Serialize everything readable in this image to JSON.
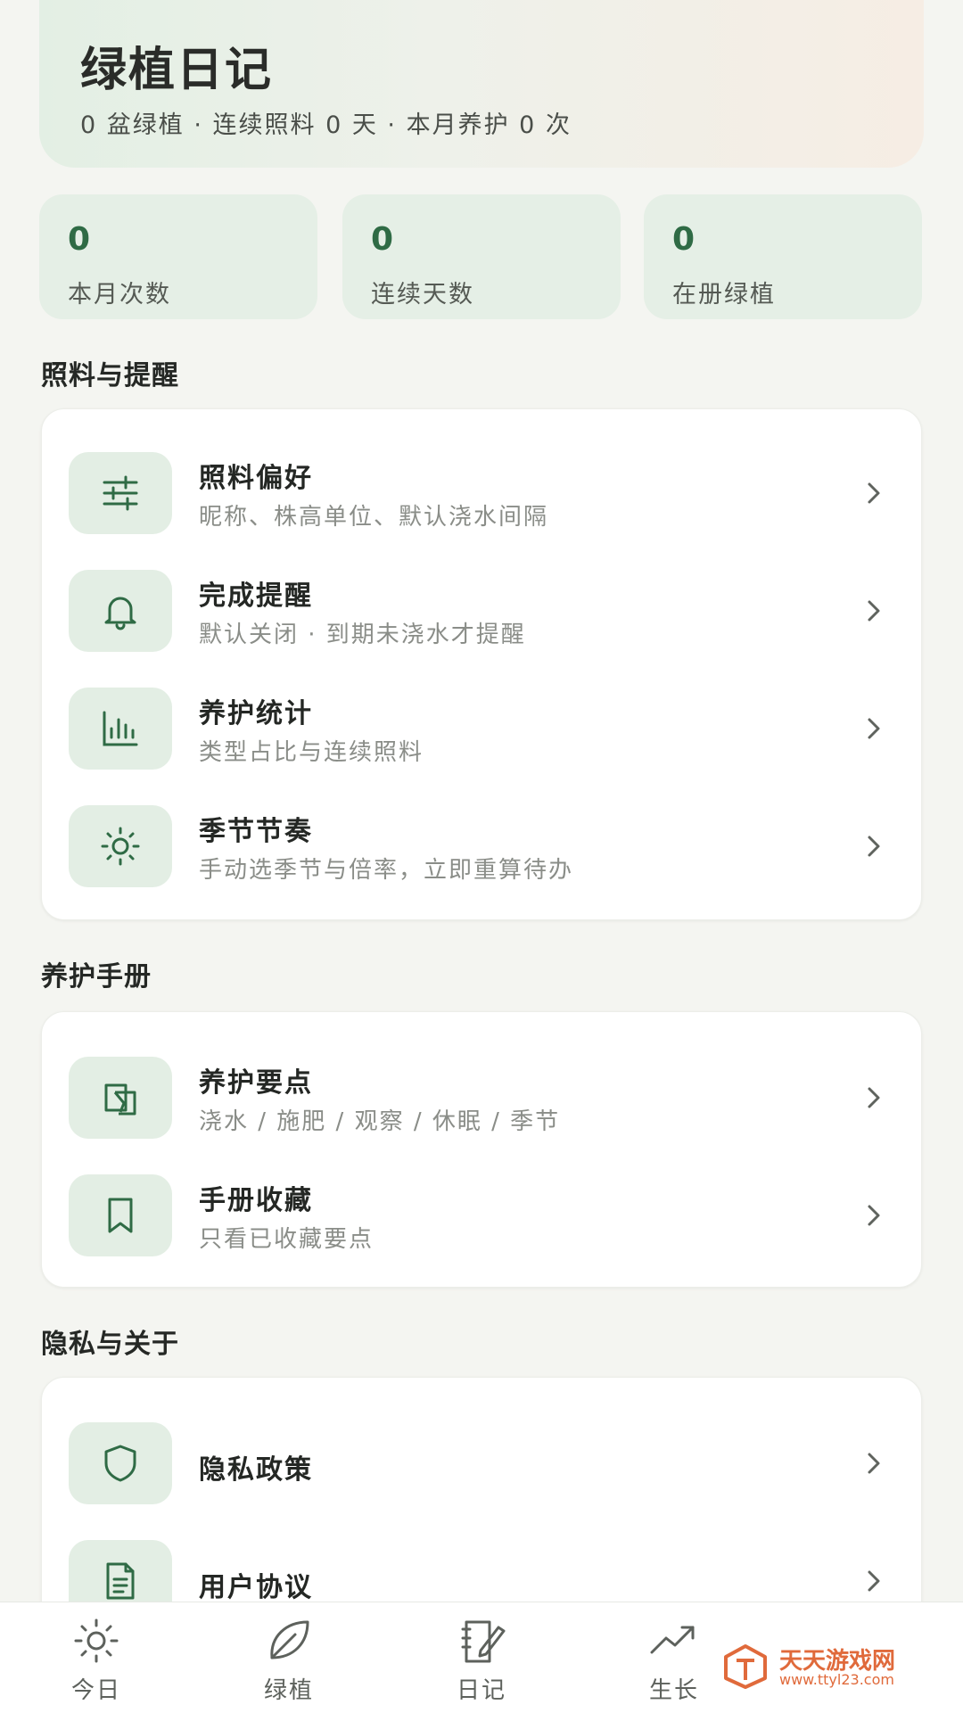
{
  "header": {
    "title": "绿植日记",
    "subtitle": "0 盆绿植 · 连续照料 0 天 · 本月养护 0 次"
  },
  "stats": [
    {
      "value": "0",
      "label": "本月次数"
    },
    {
      "value": "0",
      "label": "连续天数"
    },
    {
      "value": "0",
      "label": "在册绿植"
    }
  ],
  "sections": {
    "care": {
      "title": "照料与提醒",
      "items": [
        {
          "icon": "sliders-icon",
          "title": "照料偏好",
          "subtitle": "昵称、株高单位、默认浇水间隔"
        },
        {
          "icon": "bell-icon",
          "title": "完成提醒",
          "subtitle": "默认关闭 · 到期未浇水才提醒"
        },
        {
          "icon": "bar-chart-icon",
          "title": "养护统计",
          "subtitle": "类型占比与连续照料"
        },
        {
          "icon": "sun-icon",
          "title": "季节节奏",
          "subtitle": "手动选季节与倍率，立即重算待办"
        }
      ]
    },
    "manual": {
      "title": "养护手册",
      "items": [
        {
          "icon": "book-icon",
          "title": "养护要点",
          "subtitle": "浇水 / 施肥 / 观察 / 休眠 / 季节"
        },
        {
          "icon": "bookmark-icon",
          "title": "手册收藏",
          "subtitle": "只看已收藏要点"
        }
      ]
    },
    "privacy": {
      "title": "隐私与关于",
      "items": [
        {
          "icon": "shield-icon",
          "title": "隐私政策"
        },
        {
          "icon": "document-icon",
          "title": "用户协议"
        }
      ]
    }
  },
  "tabs": [
    {
      "icon": "sun-icon",
      "label": "今日"
    },
    {
      "icon": "leaf-icon",
      "label": "绿植"
    },
    {
      "icon": "notebook-icon",
      "label": "日记"
    },
    {
      "icon": "trend-icon",
      "label": "生长"
    }
  ],
  "watermark": {
    "title": "天天游戏网",
    "url": "www.ttyl23.com"
  },
  "colors": {
    "accent": "#2f6b45",
    "icon_bg": "#e3eee4",
    "background": "#f4f5f1"
  }
}
